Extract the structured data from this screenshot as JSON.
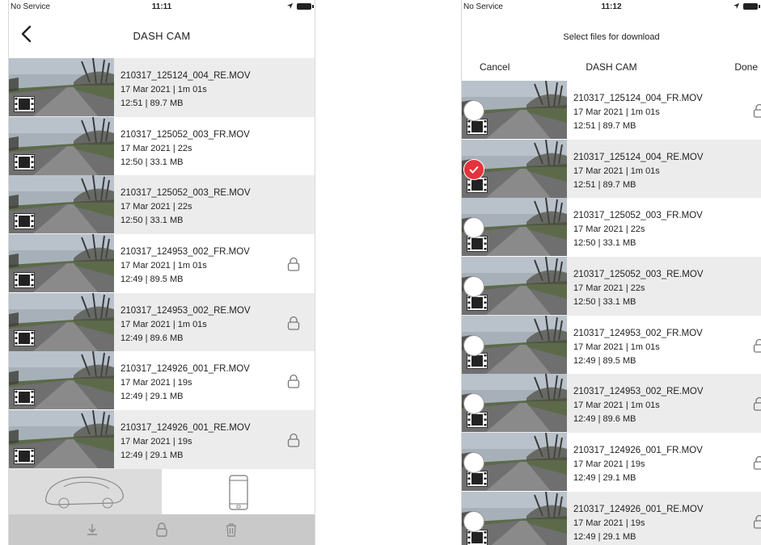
{
  "left": {
    "status": {
      "carrier": "No Service",
      "time": "11:11"
    },
    "nav": {
      "title": "DASH CAM"
    },
    "files": [
      {
        "name": "210317_125124_004_RE.MOV",
        "meta": "17 Mar 2021 |  1m 01s",
        "time_size": "12:51 | 89.7 MB",
        "locked": false,
        "alt": true
      },
      {
        "name": "210317_125052_003_FR.MOV",
        "meta": "17 Mar 2021 | 22s",
        "time_size": "12:50 | 33.1 MB",
        "locked": false,
        "alt": false
      },
      {
        "name": "210317_125052_003_RE.MOV",
        "meta": "17 Mar 2021 | 22s",
        "time_size": "12:50 | 33.1 MB",
        "locked": false,
        "alt": true
      },
      {
        "name": "210317_124953_002_FR.MOV",
        "meta": "17 Mar 2021 |  1m 01s",
        "time_size": "12:49 | 89.5 MB",
        "locked": true,
        "alt": false
      },
      {
        "name": "210317_124953_002_RE.MOV",
        "meta": "17 Mar 2021 |  1m 01s",
        "time_size": "12:49 | 89.6 MB",
        "locked": true,
        "alt": true
      },
      {
        "name": "210317_124926_001_FR.MOV",
        "meta": "17 Mar 2021 | 19s",
        "time_size": "12:49 | 29.1 MB",
        "locked": true,
        "alt": false
      },
      {
        "name": "210317_124926_001_RE.MOV",
        "meta": "17 Mar 2021 | 19s",
        "time_size": "12:49 | 29.1 MB",
        "locked": true,
        "alt": true
      }
    ]
  },
  "right": {
    "status": {
      "carrier": "No Service",
      "time": "11:12"
    },
    "subtitle": "Select files for download",
    "nav": {
      "cancel": "Cancel",
      "title": "DASH CAM",
      "done": "Done"
    },
    "files": [
      {
        "name": "210317_125124_004_FR.MOV",
        "meta": "17 Mar 2021 |  1m 01s",
        "time_size": "12:51 | 89.7 MB",
        "locked": true,
        "alt": false,
        "selected": false
      },
      {
        "name": "210317_125124_004_RE.MOV",
        "meta": "17 Mar 2021 |  1m 01s",
        "time_size": "12:51 | 89.7 MB",
        "locked": false,
        "alt": true,
        "selected": true
      },
      {
        "name": "210317_125052_003_FR.MOV",
        "meta": "17 Mar 2021 | 22s",
        "time_size": "12:50 | 33.1 MB",
        "locked": false,
        "alt": false,
        "selected": false
      },
      {
        "name": "210317_125052_003_RE.MOV",
        "meta": "17 Mar 2021 | 22s",
        "time_size": "12:50 | 33.1 MB",
        "locked": false,
        "alt": true,
        "selected": false
      },
      {
        "name": "210317_124953_002_FR.MOV",
        "meta": "17 Mar 2021 |  1m 01s",
        "time_size": "12:49 | 89.5 MB",
        "locked": true,
        "alt": false,
        "selected": false
      },
      {
        "name": "210317_124953_002_RE.MOV",
        "meta": "17 Mar 2021 |  1m 01s",
        "time_size": "12:49 | 89.6 MB",
        "locked": true,
        "alt": true,
        "selected": false
      },
      {
        "name": "210317_124926_001_FR.MOV",
        "meta": "17 Mar 2021 | 19s",
        "time_size": "12:49 | 29.1 MB",
        "locked": true,
        "alt": false,
        "selected": false
      },
      {
        "name": "210317_124926_001_RE.MOV",
        "meta": "17 Mar 2021 | 19s",
        "time_size": "12:49 | 29.1 MB",
        "locked": true,
        "alt": true,
        "selected": false
      }
    ]
  },
  "colors": {
    "selected": "#e6323c",
    "alt_row": "#ececec",
    "toolbar": "#c9c9c9"
  },
  "icons": [
    "back-chevron-icon",
    "film-icon",
    "lock-icon",
    "radio-check-icon",
    "car-icon",
    "phone-icon",
    "download-icon",
    "trash-icon"
  ]
}
